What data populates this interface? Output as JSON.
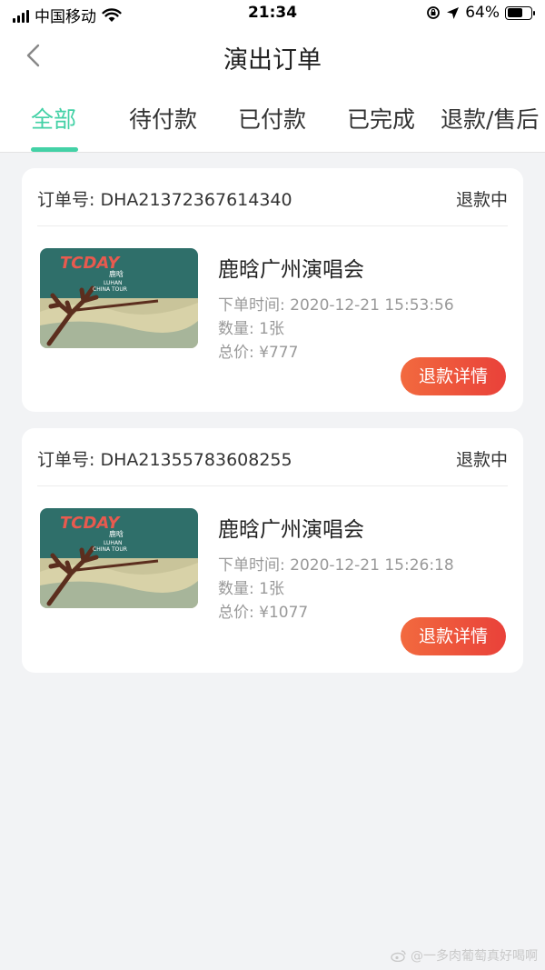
{
  "status_bar": {
    "carrier": "中国移动",
    "time": "21:34",
    "battery": "64%",
    "battery_level": 0.64
  },
  "header": {
    "title": "演出订单"
  },
  "tabs": [
    {
      "label": "全部",
      "active": true
    },
    {
      "label": "待付款",
      "active": false
    },
    {
      "label": "已付款",
      "active": false
    },
    {
      "label": "已完成",
      "active": false
    },
    {
      "label": "退款/售后",
      "active": false
    }
  ],
  "orders": [
    {
      "order_no": "订单号: DHA21372367614340",
      "status": "退款中",
      "event": "鹿晗广州演唱会",
      "order_time": "下单时间: 2020-12-21 15:53:56",
      "quantity": "数量: 1张",
      "total": "总价: ¥777",
      "button": "退款详情"
    },
    {
      "order_no": "订单号: DHA21355783608255",
      "status": "退款中",
      "event": "鹿晗广州演唱会",
      "order_time": "下单时间: 2020-12-21 15:26:18",
      "quantity": "数量: 1张",
      "total": "总价: ¥1077",
      "button": "退款详情"
    }
  ],
  "poster": {
    "line1": "TCDAY",
    "line2": "鹿晗",
    "line3": "LUHAN",
    "line4": "CHINA TOUR"
  },
  "watermark": "@一多肉葡萄真好喝啊",
  "colors": {
    "accent": "#43d1a6",
    "button": "#e9413a"
  }
}
